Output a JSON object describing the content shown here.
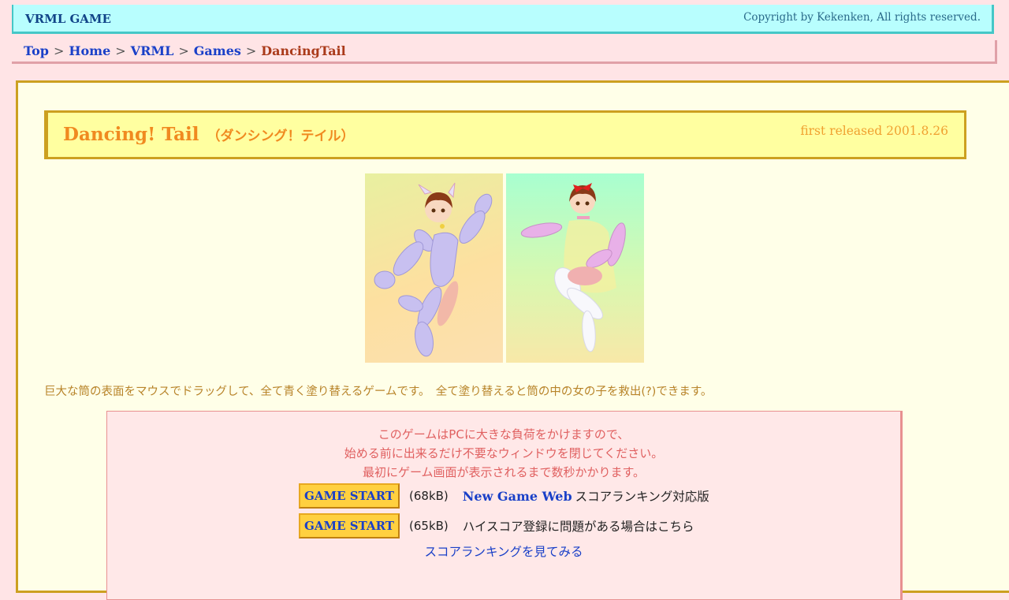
{
  "header": {
    "site_title": "VRML GAME",
    "copyright": "Copyright by Kekenken, All rights reserved."
  },
  "breadcrumb": {
    "items": [
      "Top",
      "Home",
      "VRML",
      "Games"
    ],
    "separator": ">",
    "current": "DancingTail"
  },
  "game": {
    "title": "Dancing! Tail",
    "title_kana": "（ダンシング！テイル）",
    "release": "first released 2001.8.26",
    "description": "巨大な筒の表面をマウスでドラッグして、全て青く塗り替えるゲームです。　全て塗り替えると筒の中の女の子を救出(?)できます。"
  },
  "notice": {
    "line1": "このゲームはPCに大きな負荷をかけますので、",
    "line2": "始める前に出来るだけ不要なウィンドウを閉じてください。",
    "line3": "最初にゲーム画面が表示されるまで数秒かかります。"
  },
  "starts": [
    {
      "button_label": "GAME START",
      "size": "(68kB)",
      "link_text": "New Game Web",
      "note": "スコアランキング対応版"
    },
    {
      "button_label": "GAME START",
      "size": "(65kB)",
      "note": "ハイスコア登録に問題がある場合はこちら"
    }
  ],
  "ranking_link": "スコアランキングを見てみる",
  "colors": {
    "page_bg": "#ffe4e6",
    "header_bg": "#b8fefe",
    "panel_bg": "#ffffe8",
    "title_bg": "#ffffa0",
    "link": "#1a40c8",
    "accent_orange": "#f08a20",
    "button_bg": "#ffd040"
  }
}
